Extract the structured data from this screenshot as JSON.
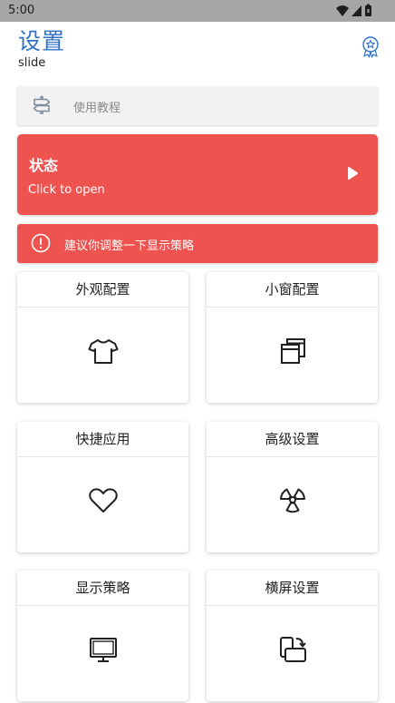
{
  "status_bar": {
    "time": "5:00"
  },
  "header": {
    "title": "设置",
    "subtitle": "slide"
  },
  "icons": {
    "badge": "award-icon",
    "tutorial": "signpost-icon",
    "state": "play-icon",
    "warning": "alert-circle-icon"
  },
  "tutorial": {
    "label": "使用教程"
  },
  "state_card": {
    "title": "状态",
    "subtitle": "Click to open"
  },
  "warning": {
    "text": "建议你调整一下显示策略"
  },
  "grid": [
    {
      "label": "外观配置",
      "icon": "tshirt-icon"
    },
    {
      "label": "小窗配置",
      "icon": "windows-icon"
    },
    {
      "label": "快捷应用",
      "icon": "heart-icon"
    },
    {
      "label": "高级设置",
      "icon": "radiation-icon"
    },
    {
      "label": "显示策略",
      "icon": "monitor-icon"
    },
    {
      "label": "横屏设置",
      "icon": "rotate-screen-icon"
    }
  ],
  "colors": {
    "accent": "#2f72c7",
    "danger": "#ef5350",
    "status_bar": "#a6a6a6"
  }
}
